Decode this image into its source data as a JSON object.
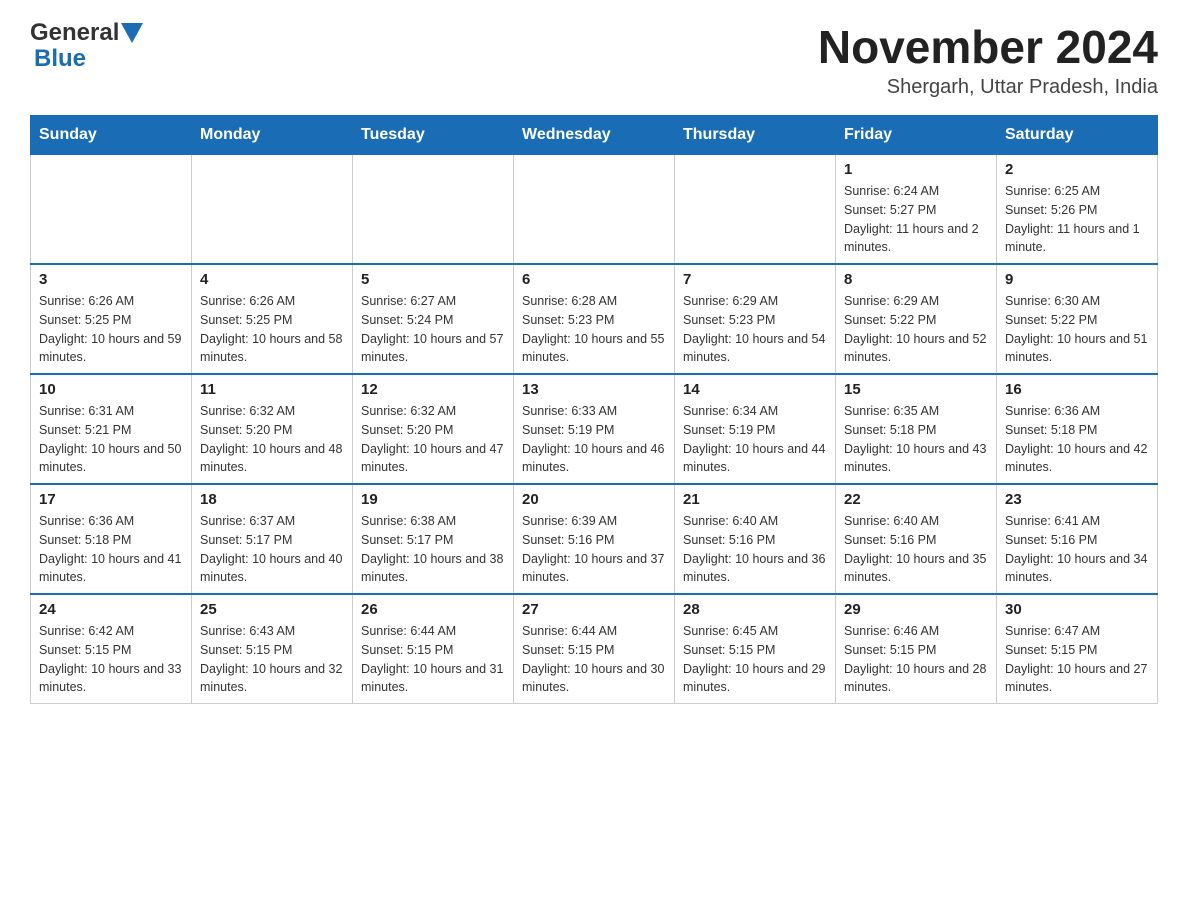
{
  "header": {
    "logo_general": "General",
    "logo_blue": "Blue",
    "title": "November 2024",
    "subtitle": "Shergarh, Uttar Pradesh, India"
  },
  "days_of_week": [
    "Sunday",
    "Monday",
    "Tuesday",
    "Wednesday",
    "Thursday",
    "Friday",
    "Saturday"
  ],
  "weeks": [
    {
      "days": [
        {
          "num": "",
          "info": ""
        },
        {
          "num": "",
          "info": ""
        },
        {
          "num": "",
          "info": ""
        },
        {
          "num": "",
          "info": ""
        },
        {
          "num": "",
          "info": ""
        },
        {
          "num": "1",
          "info": "Sunrise: 6:24 AM\nSunset: 5:27 PM\nDaylight: 11 hours and 2 minutes."
        },
        {
          "num": "2",
          "info": "Sunrise: 6:25 AM\nSunset: 5:26 PM\nDaylight: 11 hours and 1 minute."
        }
      ]
    },
    {
      "days": [
        {
          "num": "3",
          "info": "Sunrise: 6:26 AM\nSunset: 5:25 PM\nDaylight: 10 hours and 59 minutes."
        },
        {
          "num": "4",
          "info": "Sunrise: 6:26 AM\nSunset: 5:25 PM\nDaylight: 10 hours and 58 minutes."
        },
        {
          "num": "5",
          "info": "Sunrise: 6:27 AM\nSunset: 5:24 PM\nDaylight: 10 hours and 57 minutes."
        },
        {
          "num": "6",
          "info": "Sunrise: 6:28 AM\nSunset: 5:23 PM\nDaylight: 10 hours and 55 minutes."
        },
        {
          "num": "7",
          "info": "Sunrise: 6:29 AM\nSunset: 5:23 PM\nDaylight: 10 hours and 54 minutes."
        },
        {
          "num": "8",
          "info": "Sunrise: 6:29 AM\nSunset: 5:22 PM\nDaylight: 10 hours and 52 minutes."
        },
        {
          "num": "9",
          "info": "Sunrise: 6:30 AM\nSunset: 5:22 PM\nDaylight: 10 hours and 51 minutes."
        }
      ]
    },
    {
      "days": [
        {
          "num": "10",
          "info": "Sunrise: 6:31 AM\nSunset: 5:21 PM\nDaylight: 10 hours and 50 minutes."
        },
        {
          "num": "11",
          "info": "Sunrise: 6:32 AM\nSunset: 5:20 PM\nDaylight: 10 hours and 48 minutes."
        },
        {
          "num": "12",
          "info": "Sunrise: 6:32 AM\nSunset: 5:20 PM\nDaylight: 10 hours and 47 minutes."
        },
        {
          "num": "13",
          "info": "Sunrise: 6:33 AM\nSunset: 5:19 PM\nDaylight: 10 hours and 46 minutes."
        },
        {
          "num": "14",
          "info": "Sunrise: 6:34 AM\nSunset: 5:19 PM\nDaylight: 10 hours and 44 minutes."
        },
        {
          "num": "15",
          "info": "Sunrise: 6:35 AM\nSunset: 5:18 PM\nDaylight: 10 hours and 43 minutes."
        },
        {
          "num": "16",
          "info": "Sunrise: 6:36 AM\nSunset: 5:18 PM\nDaylight: 10 hours and 42 minutes."
        }
      ]
    },
    {
      "days": [
        {
          "num": "17",
          "info": "Sunrise: 6:36 AM\nSunset: 5:18 PM\nDaylight: 10 hours and 41 minutes."
        },
        {
          "num": "18",
          "info": "Sunrise: 6:37 AM\nSunset: 5:17 PM\nDaylight: 10 hours and 40 minutes."
        },
        {
          "num": "19",
          "info": "Sunrise: 6:38 AM\nSunset: 5:17 PM\nDaylight: 10 hours and 38 minutes."
        },
        {
          "num": "20",
          "info": "Sunrise: 6:39 AM\nSunset: 5:16 PM\nDaylight: 10 hours and 37 minutes."
        },
        {
          "num": "21",
          "info": "Sunrise: 6:40 AM\nSunset: 5:16 PM\nDaylight: 10 hours and 36 minutes."
        },
        {
          "num": "22",
          "info": "Sunrise: 6:40 AM\nSunset: 5:16 PM\nDaylight: 10 hours and 35 minutes."
        },
        {
          "num": "23",
          "info": "Sunrise: 6:41 AM\nSunset: 5:16 PM\nDaylight: 10 hours and 34 minutes."
        }
      ]
    },
    {
      "days": [
        {
          "num": "24",
          "info": "Sunrise: 6:42 AM\nSunset: 5:15 PM\nDaylight: 10 hours and 33 minutes."
        },
        {
          "num": "25",
          "info": "Sunrise: 6:43 AM\nSunset: 5:15 PM\nDaylight: 10 hours and 32 minutes."
        },
        {
          "num": "26",
          "info": "Sunrise: 6:44 AM\nSunset: 5:15 PM\nDaylight: 10 hours and 31 minutes."
        },
        {
          "num": "27",
          "info": "Sunrise: 6:44 AM\nSunset: 5:15 PM\nDaylight: 10 hours and 30 minutes."
        },
        {
          "num": "28",
          "info": "Sunrise: 6:45 AM\nSunset: 5:15 PM\nDaylight: 10 hours and 29 minutes."
        },
        {
          "num": "29",
          "info": "Sunrise: 6:46 AM\nSunset: 5:15 PM\nDaylight: 10 hours and 28 minutes."
        },
        {
          "num": "30",
          "info": "Sunrise: 6:47 AM\nSunset: 5:15 PM\nDaylight: 10 hours and 27 minutes."
        }
      ]
    }
  ]
}
